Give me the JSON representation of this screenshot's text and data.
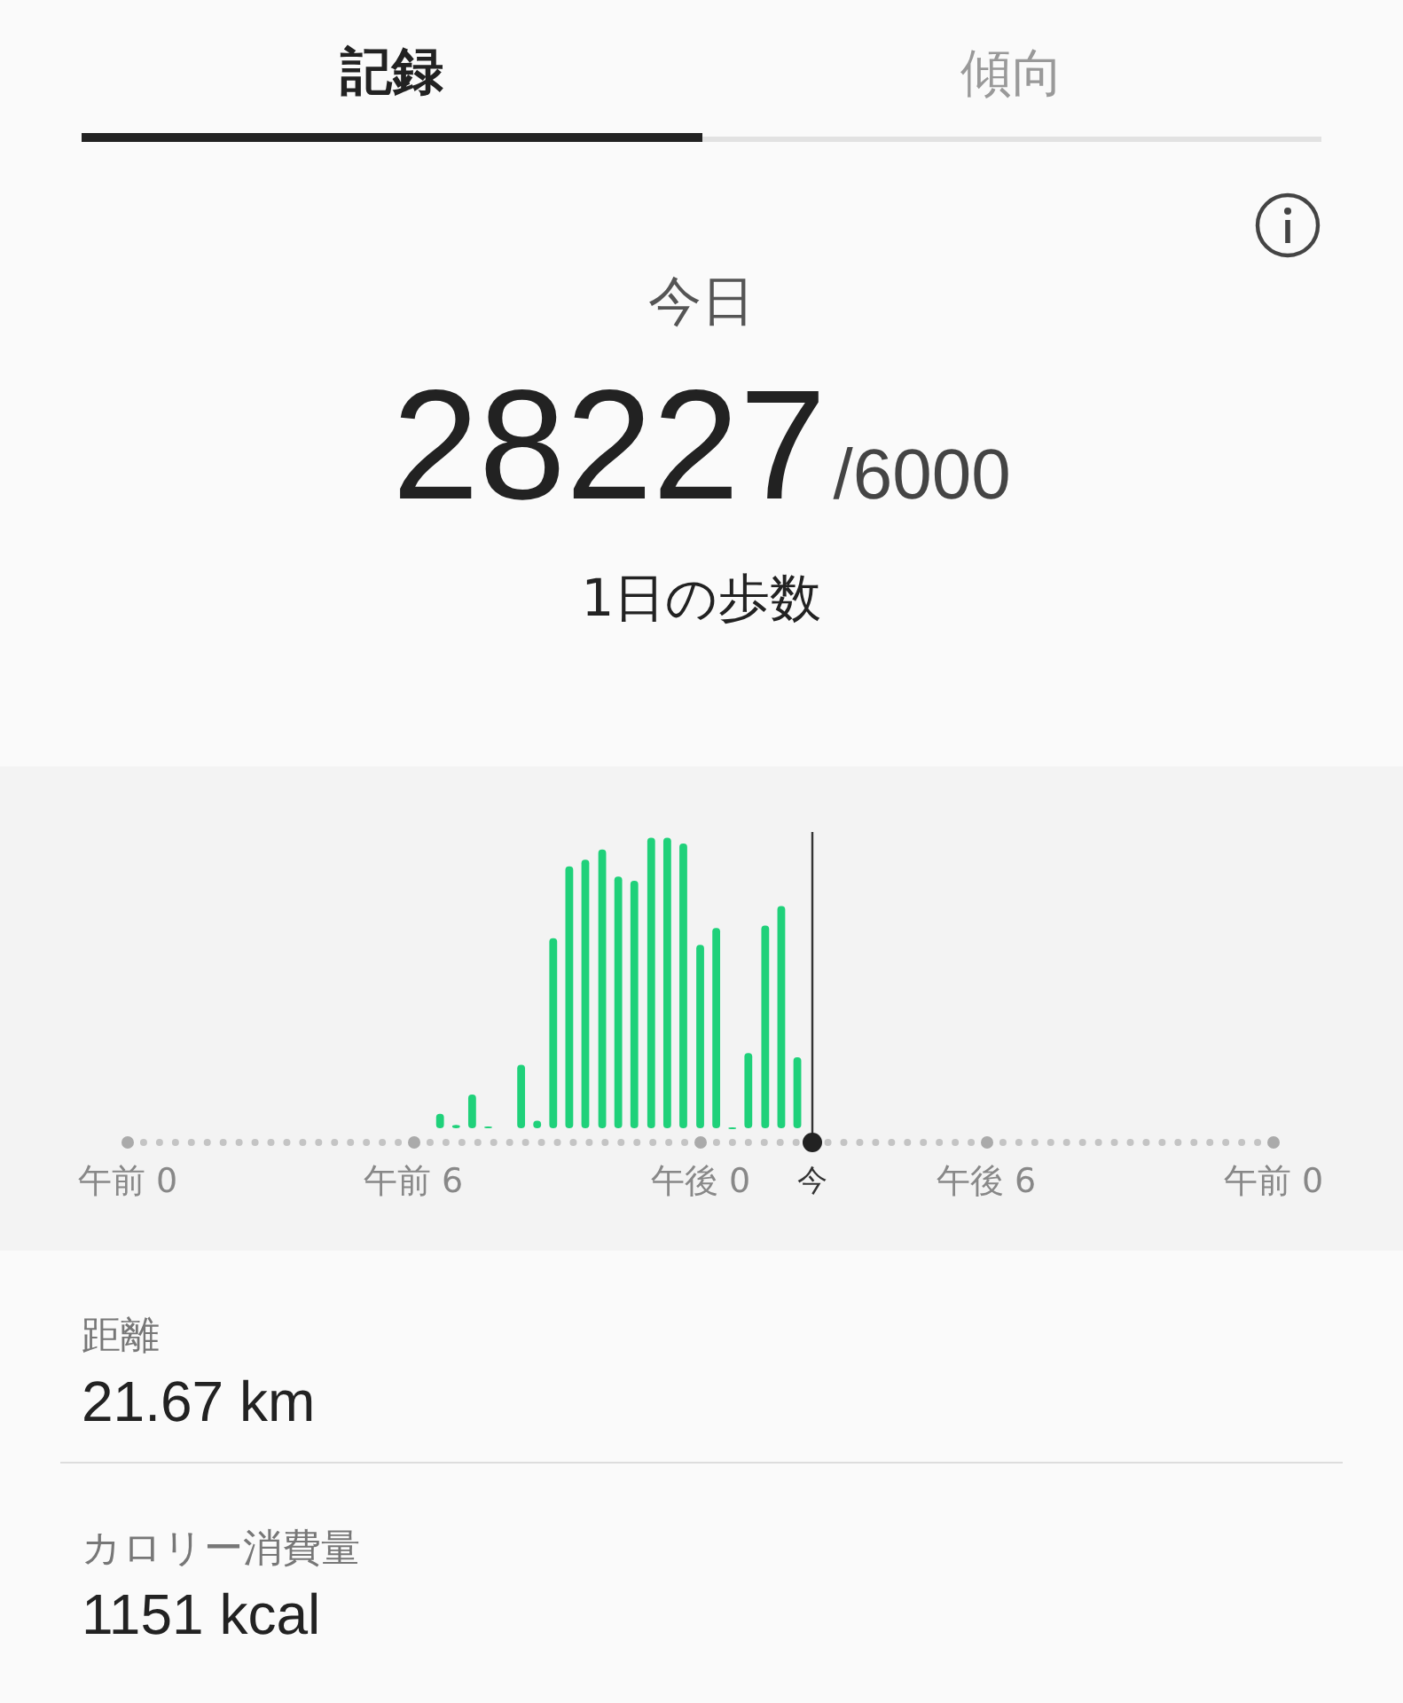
{
  "tabs": [
    {
      "label": "記録",
      "selected": true
    },
    {
      "label": "傾向",
      "selected": false
    }
  ],
  "summary": {
    "period": "今日",
    "steps": "28227",
    "goal": "/6000",
    "caption": "1日の歩数"
  },
  "timeline": {
    "labels": [
      {
        "text": "午前 0",
        "kind": "tick"
      },
      {
        "text": "午前 6",
        "kind": "tick"
      },
      {
        "text": "午後 0",
        "kind": "tick"
      },
      {
        "text": "今",
        "kind": "now"
      },
      {
        "text": "午後 6",
        "kind": "tick"
      },
      {
        "text": "午前 0",
        "kind": "tick"
      }
    ]
  },
  "stats": [
    {
      "label": "距離",
      "value": "21.67 km"
    },
    {
      "label": "カロリー消費量",
      "value": "1151 kcal"
    }
  ]
}
